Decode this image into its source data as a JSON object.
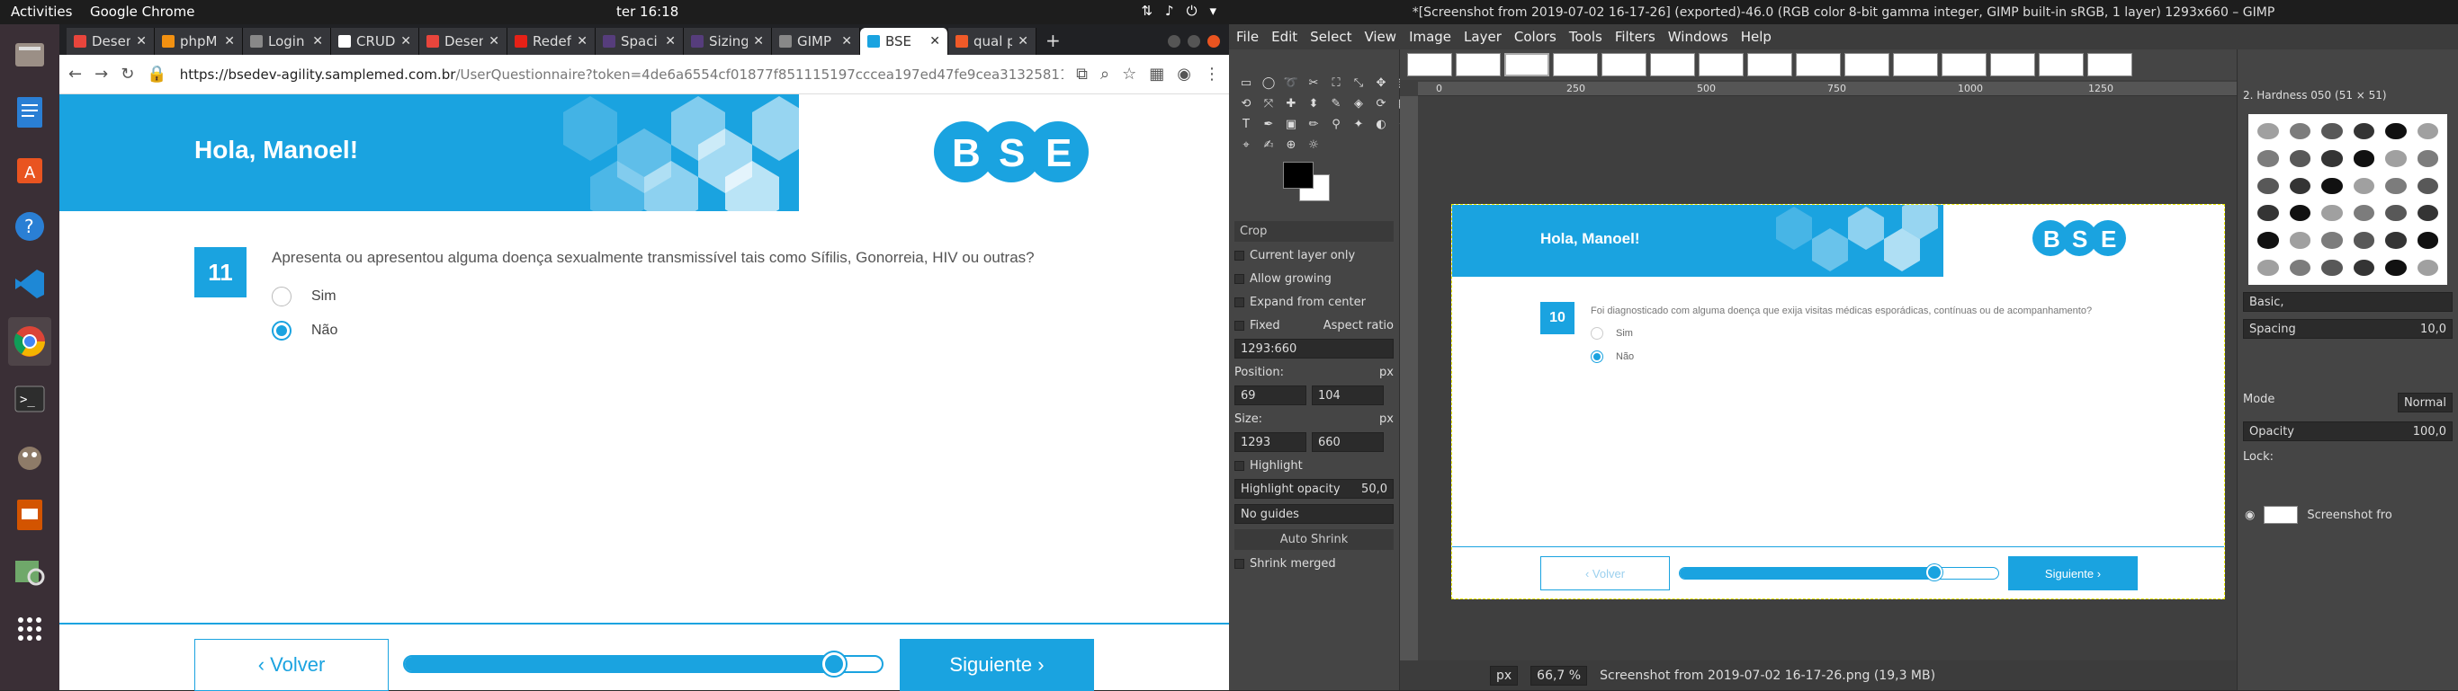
{
  "topbar": {
    "activities": "Activities",
    "app_name": "Google Chrome",
    "clock": "ter 16:18"
  },
  "chrome": {
    "tabs": [
      {
        "label": "Desen",
        "color": "#e8453c"
      },
      {
        "label": "phpM",
        "color": "#f29111"
      },
      {
        "label": "Login",
        "color": "#888888"
      },
      {
        "label": "CRUD",
        "color": "#ffffff"
      },
      {
        "label": "Desen",
        "color": "#e8453c"
      },
      {
        "label": "Redef",
        "color": "#e62117"
      },
      {
        "label": "Spaci",
        "color": "#563d7c"
      },
      {
        "label": "Sizing",
        "color": "#563d7c"
      },
      {
        "label": "GIMP",
        "color": "#888888"
      },
      {
        "label": "BSE",
        "color": "#1aa3e0"
      },
      {
        "label": "qual p",
        "color": "#f05a28"
      }
    ],
    "url_host": "https://bsedev-agility.samplemed.com.br",
    "url_path": "/UserQuestionnaire?token=4de6a6554cf01877f851115197cccea197ed47fe9cea31325811c6673c34cf7..."
  },
  "questionnaire": {
    "greeting": "Hola, Manoel!",
    "logo": "BSE",
    "question_number": "11",
    "question_text": "Apresenta ou apresentou alguma doença sexualmente transmissível tais como Sífilis, Gonorreia, HIV ou outras?",
    "options": [
      {
        "label": "Sim",
        "selected": false
      },
      {
        "label": "Não",
        "selected": true
      }
    ],
    "back_label": "‹ Volver",
    "next_label": "Siguiente ›",
    "progress": 0.9
  },
  "gimp": {
    "title": "*[Screenshot from 2019-07-02 16-17-26] (exported)-46.0 (RGB color 8-bit gamma integer, GIMP built-in sRGB, 1 layer) 1293x660 – GIMP",
    "menu": [
      "File",
      "Edit",
      "Select",
      "View",
      "Image",
      "Layer",
      "Colors",
      "Tools",
      "Filters",
      "Windows",
      "Help"
    ],
    "tool_options": {
      "section": "Crop",
      "current_layer_only": "Current layer only",
      "allow_growing": "Allow growing",
      "expand_from_center": "Expand from center",
      "fixed": "Fixed",
      "aspect_ratio": "Aspect ratio",
      "ratio_value": "1293:660",
      "position_label": "Position:",
      "pos_x": "69",
      "pos_y": "104",
      "unit": "px",
      "size_label": "Size:",
      "size_w": "1293",
      "size_h": "660",
      "highlight": "Highlight",
      "highlight_opacity": "Highlight opacity",
      "highlight_opacity_value": "50,0",
      "guides": "No guides",
      "auto_shrink": "Auto Shrink",
      "shrink_merged": "Shrink merged"
    },
    "ruler_ticks": [
      "0",
      "250",
      "500",
      "750",
      "1000",
      "1250"
    ],
    "canvas_image": {
      "greeting": "Hola, Manoel!",
      "logo": "BSE",
      "question_number": "10",
      "question_text": "Foi diagnosticado com alguma doença que exija visitas médicas esporádicas, contínuas ou de acompanhamento?",
      "options": [
        {
          "label": "Sim",
          "selected": false
        },
        {
          "label": "Não",
          "selected": true
        }
      ],
      "back_label": "‹ Volver",
      "next_label": "Siguiente ›",
      "progress": 0.8
    },
    "status": {
      "unit": "px",
      "zoom": "66,7 %",
      "file": "Screenshot from 2019-07-02 16-17-26.png (19,3 MB)"
    },
    "right_panel": {
      "brush_name": "2. Hardness 050 (51 × 51)",
      "preset": "Basic,",
      "spacing_label": "Spacing",
      "spacing_value": "10,0",
      "mode_label": "Mode",
      "mode_value": "Normal",
      "opacity_label": "Opacity",
      "opacity_value": "100,0",
      "lock_label": "Lock:",
      "layer_name": "Screenshot fro"
    }
  }
}
